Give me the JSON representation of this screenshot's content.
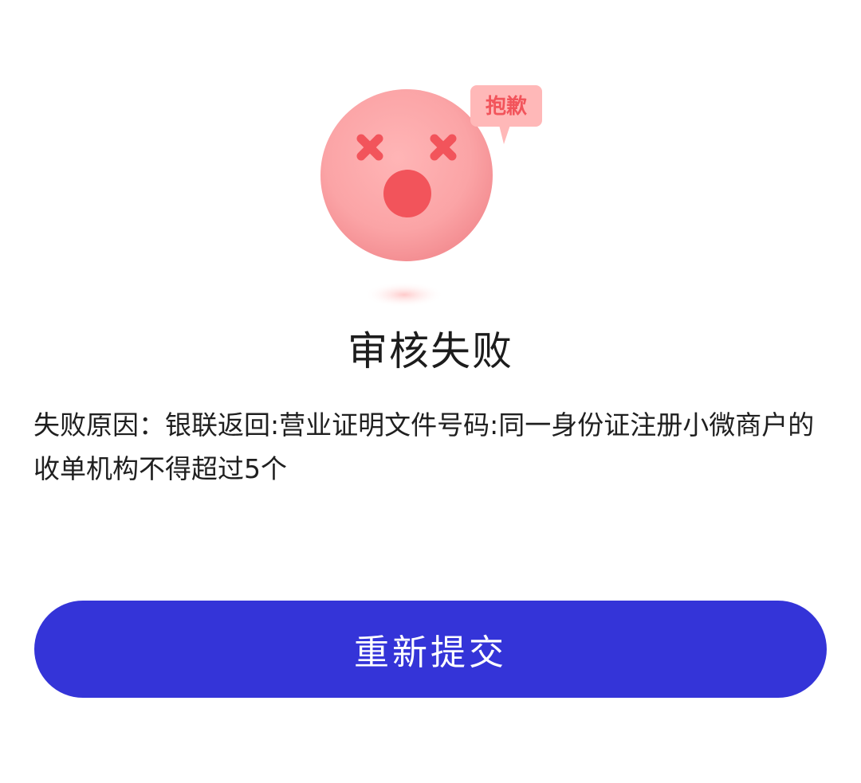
{
  "illustration": {
    "bubble_text": "抱歉",
    "face_color": "#fba4a6",
    "accent_color": "#f2545b"
  },
  "result": {
    "title": "审核失败",
    "reason": "失败原因：银联返回:营业证明文件号码:同一身份证注册小微商户的收单机构不得超过5个"
  },
  "actions": {
    "resubmit_label": "重新提交",
    "button_color": "#3434d8"
  }
}
